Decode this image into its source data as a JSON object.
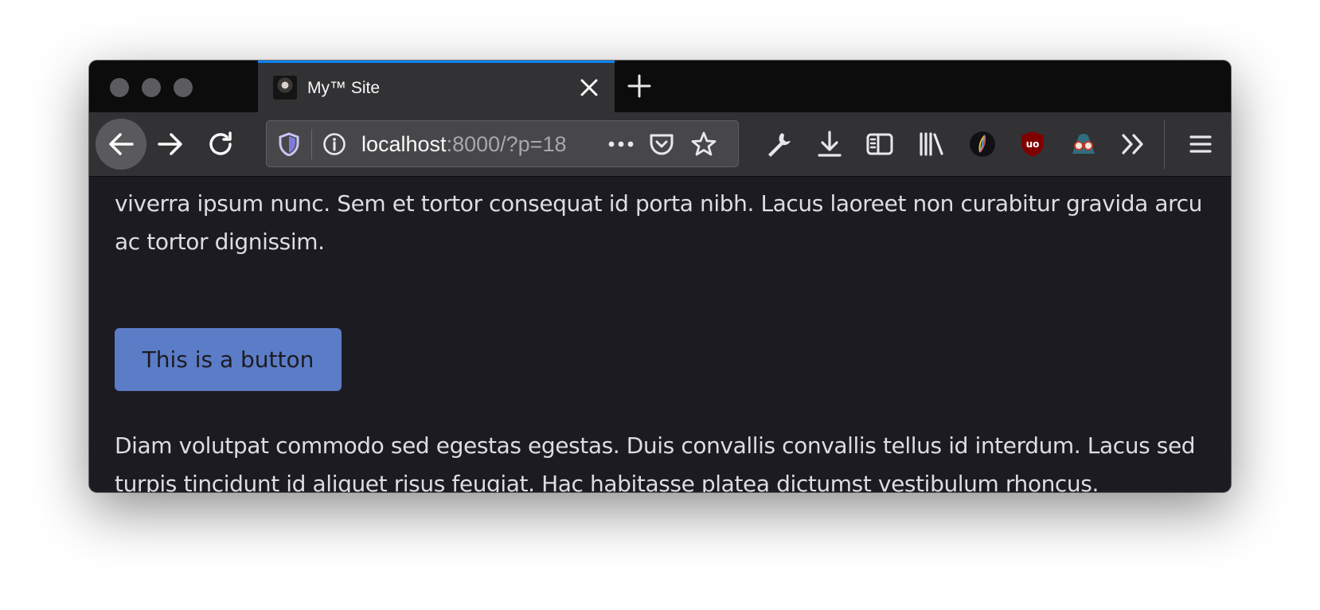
{
  "tab": {
    "title": "My™ Site"
  },
  "urlbar": {
    "host": "localhost",
    "rest": ":8000/?p=18"
  },
  "content": {
    "paragraph_top": "viverra ipsum nunc. Sem et tortor consequat id porta nibh. Lacus laoreet non curabitur gravida arcu ac tortor dignissim.",
    "button_label": "This is a button",
    "paragraph_bottom": "Diam volutpat commodo sed egestas egestas. Duis convallis convallis tellus id interdum. Lacus sed turpis tincidunt id aliquet risus feugiat. Hac habitasse platea dictumst vestibulum rhoncus."
  },
  "colors": {
    "tab_accent": "#0a84ff",
    "button_bg": "#5b7cc7",
    "page_bg": "#1c1b22"
  },
  "toolbar_icons": [
    "wrench-icon",
    "download-icon",
    "sidebar-icon",
    "library-icon",
    "extension-icon",
    "ublock-icon",
    "spy-icon",
    "overflow-icon",
    "menu-icon"
  ]
}
